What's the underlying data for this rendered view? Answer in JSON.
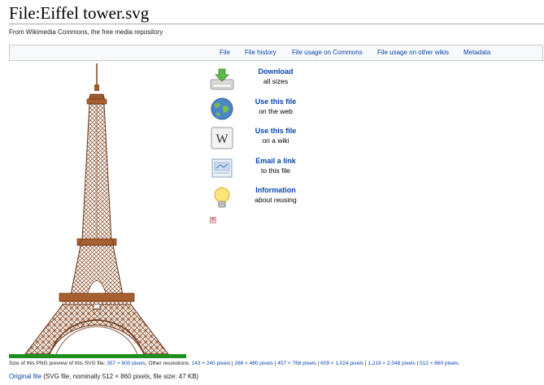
{
  "page": {
    "title": "File:Eiffel tower.svg",
    "tagline": "From Wikimedia Commons, the free media repository"
  },
  "filetoc": {
    "tabs": [
      "File",
      "File history",
      "File usage on Commons",
      "File usage on other wikis",
      "Metadata"
    ]
  },
  "image": {
    "icon": "eiffel-tower-illustration",
    "colors": {
      "steel": "#8a4a24",
      "platform": "#9b5a2c",
      "ground": "#1e8f1e"
    }
  },
  "share": {
    "items": [
      {
        "label": "Download",
        "sub": "all sizes",
        "icon": "download-icon"
      },
      {
        "label": "Use this file",
        "sub": "on the web",
        "icon": "globe-icon"
      },
      {
        "label": "Use this file",
        "sub": "on a wiki",
        "icon": "wikipedia-icon"
      },
      {
        "label": "Email a link",
        "sub": "to this file",
        "icon": "email-icon"
      },
      {
        "label": "Information",
        "sub": "about reusing",
        "icon": "lightbulb-icon"
      }
    ],
    "close_glyph": "×"
  },
  "preview": {
    "prefix": "Size of this PNG preview of this SVG file: ",
    "current": "357 × 600 pixels",
    "middle": ". Other resolutions: ",
    "resolutions": [
      "143 × 240 pixels",
      "286 × 480 pixels",
      "457 × 768 pixels",
      "609 × 1,024 pixels",
      "1,219 × 2,048 pixels",
      "512 × 860 pixels"
    ],
    "separator": " | ",
    "suffix": "."
  },
  "original": {
    "link": "Original file",
    "details": " (SVG file, nominally 512 × 860 pixels, file size: 47 KB)"
  }
}
